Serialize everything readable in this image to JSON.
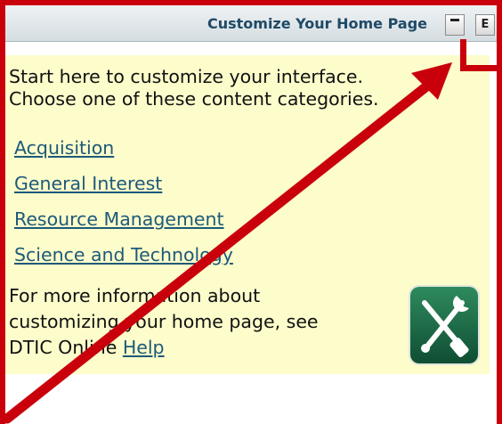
{
  "header": {
    "title": "Customize Your Home Page",
    "minimize_label": "",
    "edit_label": "E"
  },
  "intro": {
    "line1": "Start here to customize your interface.",
    "line2": "Choose one of these content categories."
  },
  "categories": [
    {
      "label": "Acquisition"
    },
    {
      "label": "General Interest"
    },
    {
      "label": "Resource Management"
    },
    {
      "label": "Science and Technology"
    }
  ],
  "more_info": {
    "line1": "For more information about",
    "line2": "customizing your home page, see",
    "line3_prefix": "DTIC Online ",
    "help_link": "Help"
  },
  "icons": {
    "tools": "tools-icon"
  },
  "colors": {
    "annotation_red": "#c9000b",
    "panel_bg": "#fdfccb",
    "link": "#1d5a7a"
  }
}
